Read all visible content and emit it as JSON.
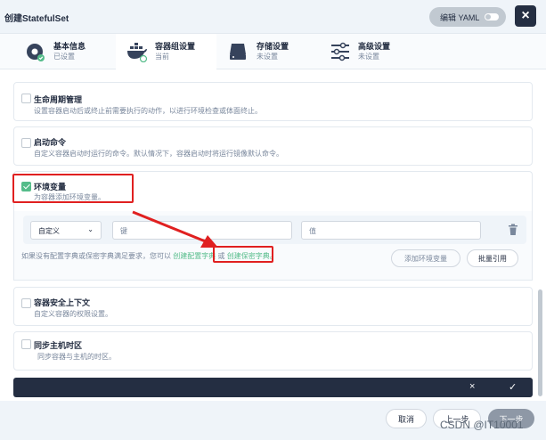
{
  "dialog": {
    "title": "创建StatefulSet",
    "yaml_label": "编辑 YAML",
    "close_label": "×"
  },
  "steps": [
    {
      "name": "基本信息",
      "status": "已设置"
    },
    {
      "name": "容器组设置",
      "status": "当前"
    },
    {
      "name": "存储设置",
      "status": "未设置"
    },
    {
      "name": "高级设置",
      "status": "未设置"
    }
  ],
  "sections": {
    "lifecycle": {
      "title": "生命周期管理",
      "desc": "设置容器启动后或终止前需要执行的动作，以进行环境检查或体面终止。",
      "checked": false
    },
    "command": {
      "title": "启动命令",
      "desc": "自定义容器启动时运行的命令。默认情况下，容器启动时将运行镜像默认命令。",
      "checked": false
    },
    "env": {
      "title": "环境变量",
      "desc": "为容器添加环境变量。",
      "checked": true
    },
    "security": {
      "title": "容器安全上下文",
      "desc": "自定义容器的权限设置。",
      "checked": false
    },
    "timezone": {
      "title": "同步主机时区",
      "desc": "同步容器与主机的时区。",
      "checked": false
    }
  },
  "env_row": {
    "type_value": "自定义",
    "key_placeholder": "键",
    "value_placeholder": "值"
  },
  "env_hint": {
    "text": "如果没有配置字典或保密字典满足要求，您可以",
    "link_configmap": "创建配置字典",
    "or": "或",
    "link_secret": "创建保密字典。"
  },
  "env_buttons": {
    "add": "添加环境变量",
    "batch": "批量引用"
  },
  "darkbar": {
    "cancel": "×",
    "confirm": "✓"
  },
  "footer": {
    "cancel": "取消",
    "prev": "上一步",
    "next": "下一步"
  },
  "watermark": "CSDN @IT10001",
  "colors": {
    "accent": "#55bc8a",
    "highlight": "#e02020",
    "dark": "#242e42"
  }
}
